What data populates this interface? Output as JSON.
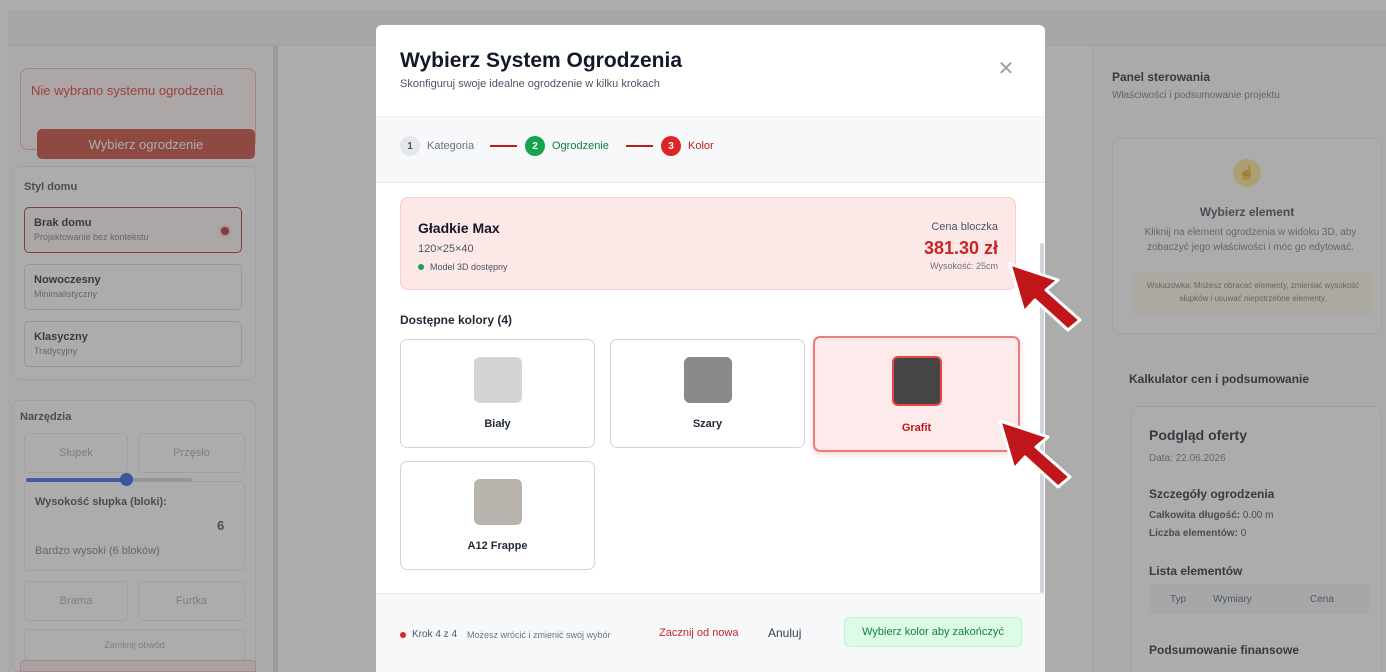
{
  "sidebar": {
    "warning": "Nie wybrano systemu ogrodzenia",
    "choose_button": "Wybierz ogrodzenie",
    "house_style_title": "Styl domu",
    "house_styles": [
      {
        "name": "Brak domu",
        "desc": "Projektowanie bez kontekstu"
      },
      {
        "name": "Nowoczesny",
        "desc": "Minimalistyczny"
      },
      {
        "name": "Klasyczny",
        "desc": "Tradycyjny"
      }
    ],
    "tools_title": "Narzędzia",
    "tool_post": "Słupek",
    "tool_span": "Przęsło",
    "post_height_label": "Wysokość słupka (bloki):",
    "post_height_value": "6",
    "post_height_fraction": 0.6,
    "post_height_desc": "Bardzo wysoki (6 bloków)",
    "tool_gate": "Brama",
    "tool_wicket": "Furtka",
    "close_loop": "Zamknij obwód"
  },
  "right_panel": {
    "title": "Panel sterowania",
    "subtitle": "Właściwości i podsumowanie projektu",
    "select_title": "Wybierz element",
    "select_desc": "Kliknij na element ogrodzenia w widoku 3D, aby zobaczyć jego właściwości i móc go edytować.",
    "tip": "Wskazówka: Możesz obracać elementy, zmieniać wysokość słupków i usuwać niepotrzebne elementy.",
    "calc_title": "Kalkulator cen i podsumowanie",
    "offer_title": "Podgląd oferty",
    "offer_date": "Data: 22.06.2026",
    "details_title": "Szczegóły ogrodzenia",
    "total_length_label": "Całkowita długość:",
    "total_length_value": "0.00 m",
    "elements_count_label": "Liczba elementów:",
    "elements_count_value": "0",
    "list_title": "Lista elementów",
    "list_headers": [
      "Typ",
      "Wymiary",
      "Cena"
    ],
    "finance_title": "Podsumowanie finansowe"
  },
  "modal": {
    "title": "Wybierz System Ogrodzenia",
    "subtitle": "Skonfiguruj swoje idealne ogrodzenie w kilku krokach",
    "steps": [
      {
        "num": "1",
        "label": "Kategoria"
      },
      {
        "num": "2",
        "label": "Ogrodzenie"
      },
      {
        "num": "3",
        "label": "Kolor"
      }
    ],
    "product": {
      "name": "Gładkie Max",
      "dims": "120×25×40",
      "model": "Model 3D dostępny",
      "price_label": "Cena bloczka",
      "price": "381.30 zł",
      "height": "Wysokość: 25cm"
    },
    "colors_title": "Dostępne kolory (4)",
    "colors": [
      {
        "name": "Biały",
        "swatch": "#d4d4d6"
      },
      {
        "name": "Szary",
        "swatch": "#8a8a8a"
      },
      {
        "name": "Grafit",
        "swatch": "#454545"
      },
      {
        "name": "A12 Frappe",
        "swatch": "#b8b4ad"
      }
    ],
    "footer": {
      "step": "Krok 4 z 4",
      "hint": "Możesz wrócić i zmienić swój wybór",
      "reset": "Zacznij od nowa",
      "cancel": "Anuluj",
      "choose": "Wybierz kolor aby zakończyć"
    }
  },
  "colors": {
    "accent_red": "#c62828",
    "accent_green": "#16a34a",
    "annotation_arrow": "#c0161a"
  }
}
